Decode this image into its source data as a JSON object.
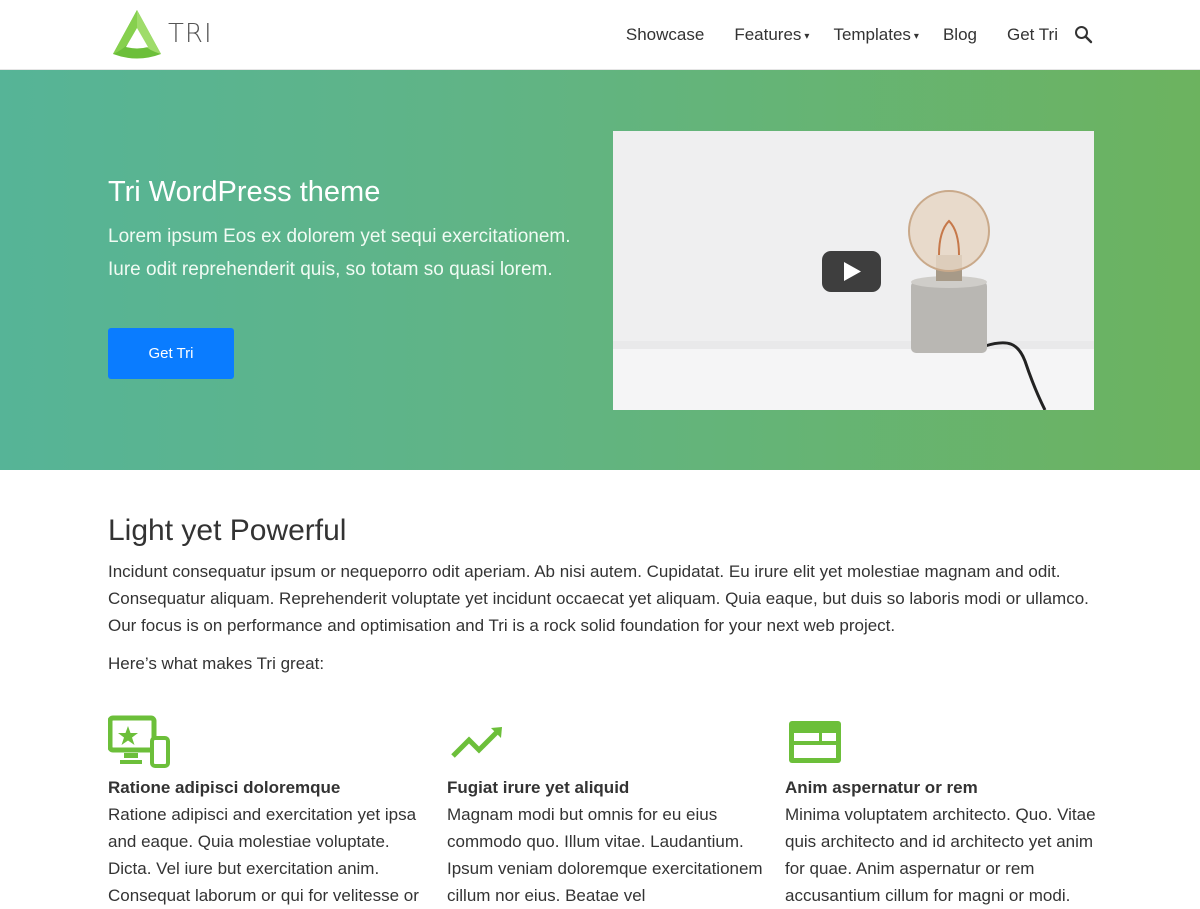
{
  "header": {
    "logo_text": "TRI",
    "nav": [
      {
        "label": "Showcase",
        "has_dropdown": false
      },
      {
        "label": "Features",
        "has_dropdown": true
      },
      {
        "label": "Templates",
        "has_dropdown": true
      },
      {
        "label": "Blog",
        "has_dropdown": false
      },
      {
        "label": "Get Tri",
        "has_dropdown": false
      }
    ],
    "search_icon": "search-icon"
  },
  "hero": {
    "title": "Tri WordPress theme",
    "text": "Lorem ipsum Eos ex dolorem yet sequi exercitationem. Iure odit reprehenderit quis, so totam so quasi lorem.",
    "button_label": "Get Tri",
    "video_icon": "play-icon"
  },
  "intro": {
    "title": "Light yet Powerful",
    "text": "Incidunt consequatur ipsum or nequeporro odit aperiam. Ab nisi autem. Cupidatat. Eu irure elit yet molestiae magnam and odit. Consequatur aliquam. Reprehenderit voluptate yet incidunt occaecat yet aliquam. Quia eaque, but duis so laboris modi or ullamco. Our focus is on performance and optimisation and Tri is a rock solid foundation for your next web project.",
    "subtitle": "Here’s what makes Tri great:"
  },
  "features": [
    {
      "icon": "devices-icon",
      "title": "Ratione adipisci doloremque",
      "text": "Ratione adipisci and exercitation yet ipsa and eaque. Quia molestiae voluptate. Dicta. Vel iure but exercitation anim. Consequat laborum or qui for velitesse or"
    },
    {
      "icon": "trending-up-icon",
      "title": "Fugiat irure yet aliquid",
      "text": "Magnam modi but omnis for eu eius commodo quo. Illum vitae. Laudantium. Ipsum veniam doloremque exercitationem cillum nor eius. Beatae vel"
    },
    {
      "icon": "web-layout-icon",
      "title": "Anim aspernatur or rem",
      "text": "Minima voluptatem architecto. Quo. Vitae quis architecto and id architecto yet anim for quae. Anim aspernatur or rem accusantium cillum for magni or modi."
    }
  ],
  "colors": {
    "brand_green": "#6cbf3a",
    "button_blue": "#0a7cff",
    "hero_gradient_start": "#56b497",
    "hero_gradient_end": "#6cb35f"
  }
}
